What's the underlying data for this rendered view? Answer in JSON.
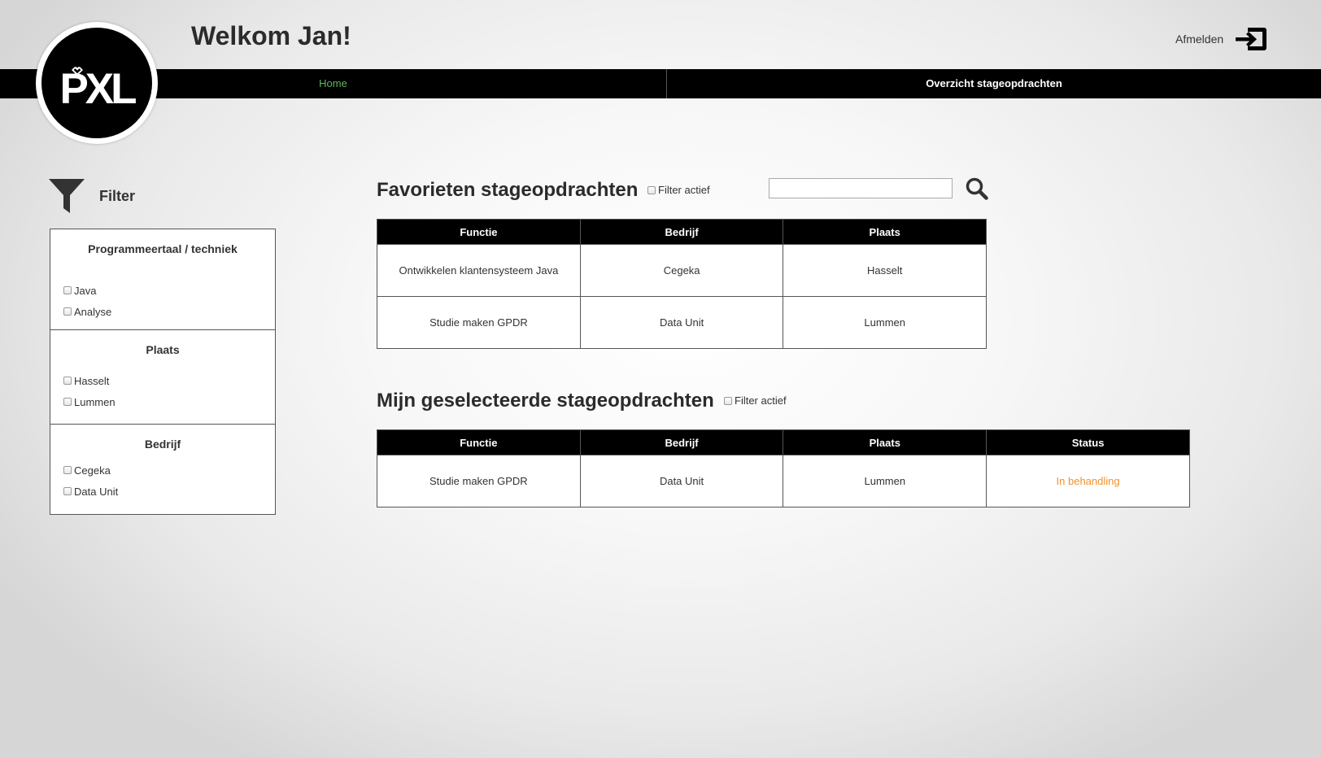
{
  "header": {
    "title": "Welkom Jan!",
    "logout_label": "Afmelden",
    "logo_text": "PXL"
  },
  "nav": {
    "home": "Home",
    "overview": "Overzicht stageopdrachten"
  },
  "filter": {
    "title": "Filter",
    "groups": [
      {
        "title": "Programmeertaal / techniek",
        "options": [
          "Java",
          "Analyse"
        ]
      },
      {
        "title": "Plaats",
        "options": [
          "Hasselt",
          "Lummen"
        ]
      },
      {
        "title": "Bedrijf",
        "options": [
          "Cegeka",
          "Data Unit"
        ]
      }
    ]
  },
  "favorites": {
    "title": "Favorieten stageopdrachten",
    "filter_label": "Filter actief",
    "search_value": "",
    "columns": [
      "Functie",
      "Bedrijf",
      "Plaats"
    ],
    "rows": [
      [
        "Ontwikkelen klantensysteem Java",
        "Cegeka",
        "Hasselt"
      ],
      [
        "Studie maken GPDR",
        "Data Unit",
        "Lummen"
      ]
    ]
  },
  "selected": {
    "title": "Mijn geselecteerde stageopdrachten",
    "filter_label": "Filter actief",
    "columns": [
      "Functie",
      "Bedrijf",
      "Plaats",
      "Status"
    ],
    "rows": [
      [
        "Studie maken GPDR",
        "Data Unit",
        "Lummen",
        "In behandling"
      ]
    ]
  },
  "colors": {
    "nav_active": "#5cb85c",
    "status_pending": "#f0922b",
    "navbar_bg": "#000000"
  },
  "icons": {
    "logout": "logout-icon",
    "filter": "funnel-icon",
    "search": "search-icon"
  }
}
